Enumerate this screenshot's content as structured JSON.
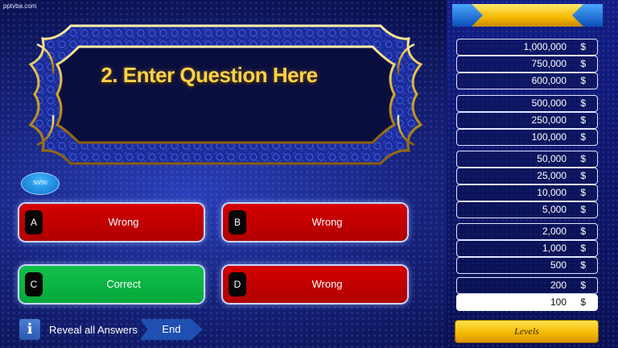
{
  "site": "pptvba.com",
  "question": {
    "text": "2. Enter Question Here"
  },
  "lifeline": {
    "label": "50/50"
  },
  "answers": [
    {
      "letter": "A",
      "text": "Wrong",
      "state": "wrong"
    },
    {
      "letter": "B",
      "text": "Wrong",
      "state": "wrong"
    },
    {
      "letter": "C",
      "text": "Correct",
      "state": "correct"
    },
    {
      "letter": "D",
      "text": "Wrong",
      "state": "wrong"
    }
  ],
  "bottom": {
    "reveal_label": "Reveal all Answers",
    "end_label": "End",
    "info_icon": "info-icon"
  },
  "levels": [
    {
      "amount": "1,000,000",
      "currency": "$"
    },
    {
      "amount": "750,000",
      "currency": "$"
    },
    {
      "amount": "600,000",
      "currency": "$"
    },
    {
      "amount": "500,000",
      "currency": "$"
    },
    {
      "amount": "250,000",
      "currency": "$"
    },
    {
      "amount": "100,000",
      "currency": "$"
    },
    {
      "amount": "50,000",
      "currency": "$"
    },
    {
      "amount": "25,000",
      "currency": "$"
    },
    {
      "amount": "10,000",
      "currency": "$"
    },
    {
      "amount": "5,000",
      "currency": "$"
    },
    {
      "amount": "2,000",
      "currency": "$"
    },
    {
      "amount": "1,000",
      "currency": "$"
    },
    {
      "amount": "500",
      "currency": "$"
    },
    {
      "amount": "200",
      "currency": "$"
    },
    {
      "amount": "100",
      "currency": "$",
      "current": true
    }
  ],
  "levels_button": "Levels",
  "colors": {
    "wrong": "#c00000",
    "correct": "#00b050",
    "gold": "#ffd24a",
    "accent": "#1f4fb0"
  }
}
